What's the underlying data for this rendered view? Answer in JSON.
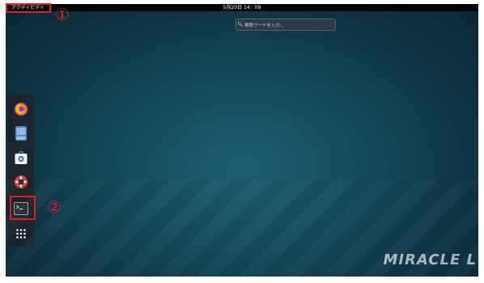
{
  "topbar": {
    "activities_label": "アクティビティ",
    "clock": "5月20日 14：09"
  },
  "search": {
    "placeholder": "検索ワードを入力…"
  },
  "dock": {
    "apps": [
      {
        "name": "firefox",
        "icon": "firefox-icon"
      },
      {
        "name": "files",
        "icon": "files-icon"
      },
      {
        "name": "software",
        "icon": "software-bag-icon"
      },
      {
        "name": "help",
        "icon": "help-lifebuoy-icon"
      },
      {
        "name": "terminal",
        "icon": "terminal-icon"
      },
      {
        "name": "show-applications",
        "icon": "grid-icon"
      }
    ]
  },
  "annotations": {
    "label1": "①",
    "label2": "②"
  },
  "brand": {
    "logo_text": "MIRACLE L"
  },
  "colors": {
    "callout": "#e02020",
    "topbar": "#000000"
  }
}
